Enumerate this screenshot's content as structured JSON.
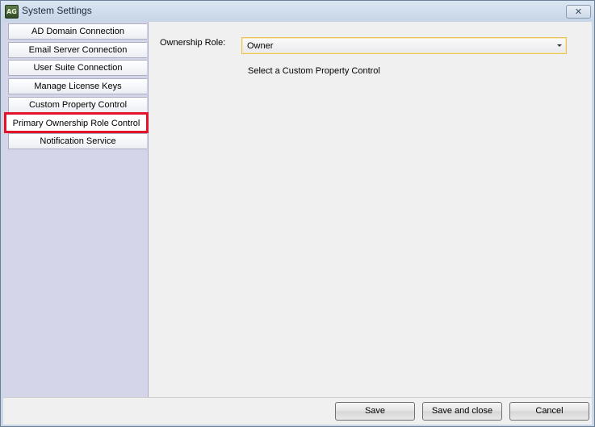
{
  "window": {
    "title": "System Settings",
    "app_icon_text": "AG",
    "close_glyph": "✕"
  },
  "sidebar": {
    "tabs": [
      {
        "label": "AD Domain Connection"
      },
      {
        "label": "Email Server Connection"
      },
      {
        "label": "User Suite Connection"
      },
      {
        "label": "Manage License Keys"
      },
      {
        "label": "Custom Property Control"
      },
      {
        "label": "Primary Ownership Role Control",
        "selected": true,
        "highlighted": true
      },
      {
        "label": "Notification Service"
      }
    ]
  },
  "main": {
    "ownership_role_label": "Ownership Role:",
    "ownership_role_value": "Owner",
    "hint_text": "Select a Custom Property Control"
  },
  "footer": {
    "save_label": "Save",
    "save_close_label": "Save and close",
    "cancel_label": "Cancel"
  },
  "colors": {
    "highlight_border": "#e2132a",
    "sidebar_bg": "#d4d5e8",
    "select_border": "#e8c45a"
  }
}
